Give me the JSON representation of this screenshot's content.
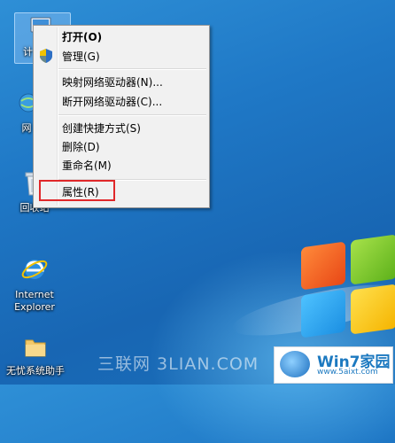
{
  "desktop": {
    "icons": [
      {
        "name": "computer",
        "label": "计"
      },
      {
        "name": "network",
        "label": "网"
      },
      {
        "name": "recycle-bin",
        "label": "回收站"
      },
      {
        "name": "internet-explorer",
        "label": "Internet Explorer"
      },
      {
        "name": "folder",
        "label": "无忧系统助手"
      }
    ]
  },
  "context_menu": {
    "items": [
      {
        "label": "打开(O)"
      },
      {
        "label": "管理(G)"
      },
      {
        "label": "映射网络驱动器(N)..."
      },
      {
        "label": "断开网络驱动器(C)..."
      },
      {
        "label": "创建快捷方式(S)"
      },
      {
        "label": "删除(D)"
      },
      {
        "label": "重命名(M)"
      },
      {
        "label": "属性(R)"
      }
    ]
  },
  "watermark": {
    "text": "三联网 3LIAN.COM",
    "badge_title": "Win7家园",
    "badge_url": "www.5aixt.com"
  },
  "colors": {
    "accent": "#1c79c0",
    "highlight": "#e0282a"
  }
}
